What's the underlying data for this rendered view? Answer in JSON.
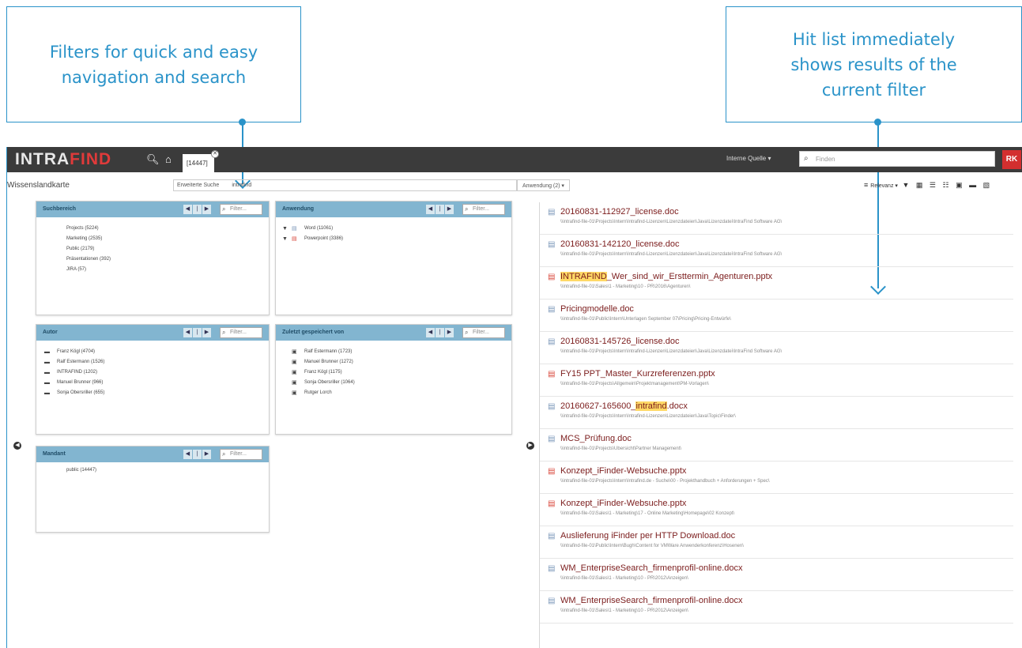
{
  "callouts": {
    "left": {
      "line1": "Filters for quick and easy",
      "line2": "navigation and search"
    },
    "right": {
      "line1": "Hit list immediately",
      "line2": "shows results of the",
      "line3": "current filter"
    }
  },
  "topbar": {
    "logo_a": "INTRA",
    "logo_b": "FIND",
    "tab_label": "[14447]",
    "source_label": "Interne Quelle ▾",
    "search_placeholder": "Finden",
    "avatar": "RK"
  },
  "subbar": {
    "page_title": "Wissenslandkarte",
    "adv_search_label": "Erweiterte Suche",
    "search_query": "intrafind",
    "app_filter": "Anwendung (2) ▾",
    "view_label": "Relevanz ▾"
  },
  "panels": [
    {
      "title": "Suchbereich",
      "filter": "Filter...",
      "items": [
        {
          "label": "Projects (5224)"
        },
        {
          "label": "Marketing (2535)"
        },
        {
          "label": "Public (2179)"
        },
        {
          "label": "Präsentationen (392)"
        },
        {
          "label": "JIRA (57)"
        }
      ]
    },
    {
      "title": "Anwendung",
      "filter": "Filter...",
      "items": [
        {
          "label": "Word (11061)",
          "icon": "word"
        },
        {
          "label": "Powerpoint (3386)",
          "icon": "ppt"
        }
      ]
    },
    {
      "title": "Autor",
      "filter": "Filter...",
      "items": [
        {
          "label": "Franz Kögl (4704)"
        },
        {
          "label": "Ralf Estermann (1526)"
        },
        {
          "label": "INTRAFIND (1202)"
        },
        {
          "label": "Manuel Brunner (966)"
        },
        {
          "label": "Sonja Obersriller (655)"
        }
      ]
    },
    {
      "title": "Zuletzt gespeichert von",
      "filter": "Filter...",
      "items": [
        {
          "label": "Ralf Estermann (1723)"
        },
        {
          "label": "Manuel Brunner (1272)"
        },
        {
          "label": "Franz Kögl (1175)"
        },
        {
          "label": "Sonja Obersriller (1064)"
        },
        {
          "label": "Rutger Lorch"
        }
      ]
    },
    {
      "title": "Mandant",
      "filter": "Filter...",
      "items": [
        {
          "label": "public (14447)"
        }
      ]
    }
  ],
  "hits": [
    {
      "type": "doc",
      "pre": "20160831-112927_license.doc",
      "mark": "",
      "post": "",
      "path": "\\\\intrafind-file-01\\Projects\\Intern\\Intrafind-Lizenzen\\Lizenzdateien\\Java\\Lizenzdatei\\IntraFind Software AG\\"
    },
    {
      "type": "doc",
      "pre": "20160831-142120_license.doc",
      "mark": "",
      "post": "",
      "path": "\\\\intrafind-file-01\\Projects\\Intern\\Intrafind-Lizenzen\\Lizenzdateien\\Java\\Lizenzdatei\\IntraFind Software AG\\"
    },
    {
      "type": "ppt",
      "pre": "",
      "mark": "INTRAFIND",
      "post": "_Wer_sind_wir_Ersttermin_Agenturen.pptx",
      "path": "\\\\intrafind-file-01\\Sales\\1 - Marketing\\10 - PR\\2016\\Agenturen\\"
    },
    {
      "type": "doc",
      "pre": "Pricingmodelle.doc",
      "mark": "",
      "post": "",
      "path": "\\\\intrafind-file-01\\Public\\Intern\\Unterlagen September 07\\Pricing\\Pricing-Entwürfe\\"
    },
    {
      "type": "doc",
      "pre": "20160831-145726_license.doc",
      "mark": "",
      "post": "",
      "path": "\\\\intrafind-file-01\\Projects\\Intern\\Intrafind-Lizenzen\\Lizenzdateien\\Java\\Lizenzdatei\\IntraFind Software AG\\"
    },
    {
      "type": "ppt",
      "pre": "FY15 PPT_Master_Kurzreferenzen.pptx",
      "mark": "",
      "post": "",
      "path": "\\\\intrafind-file-01\\Projects\\Allgemein\\Projektmanagement\\PM-Vorlagen\\"
    },
    {
      "type": "doc",
      "pre": "20160627-165600_",
      "mark": "intrafind",
      "post": ".docx",
      "path": "\\\\intrafind-file-01\\Projects\\Intern\\Intrafind-Lizenzen\\Lizenzdateien\\Java\\Topic\\Finder\\"
    },
    {
      "type": "doc",
      "pre": "MCS_Prüfung.doc",
      "mark": "",
      "post": "",
      "path": "\\\\intrafind-file-01\\Projects\\Ubersicht\\Partner Management\\"
    },
    {
      "type": "ppt",
      "pre": "Konzept_iFinder-Websuche.pptx",
      "mark": "",
      "post": "",
      "path": "\\\\intrafind-file-01\\Projects\\Intern\\Intrafind.de - Suche\\00 - Projekthandbuch + Anforderungen + Spec\\"
    },
    {
      "type": "ppt",
      "pre": "Konzept_iFinder-Websuche.pptx",
      "mark": "",
      "post": "",
      "path": "\\\\intrafind-file-01\\Sales\\1 - Marketing\\17 - Online Marketing\\Homepage\\02 Konzept\\"
    },
    {
      "type": "doc",
      "pre": "Auslieferung iFinder per HTTP Download.doc",
      "mark": "",
      "post": "",
      "path": "\\\\intrafind-file-01\\Public\\Intern\\Bugh\\Content for VMWare Anwenderkonferenz\\Hosenen\\"
    },
    {
      "type": "doc",
      "pre": "WM_EnterpriseSearch_firmenprofil-online.docx",
      "mark": "",
      "post": "",
      "path": "\\\\intrafind-file-01\\Sales\\1 - Marketing\\10 - PR\\2012\\Anzeigen\\"
    },
    {
      "type": "doc",
      "pre": "WM_EnterpriseSearch_firmenprofil-online.docx",
      "mark": "",
      "post": "",
      "path": "\\\\intrafind-file-01\\Sales\\1 - Marketing\\10 - PR\\2012\\Anzeigen\\"
    }
  ],
  "colors": {
    "accent": "#2a93c9",
    "panel_head": "#82b5d0",
    "topbar": "#3b3b3b",
    "hit_title": "#7b1c1c",
    "avatar": "#d32f2f"
  }
}
